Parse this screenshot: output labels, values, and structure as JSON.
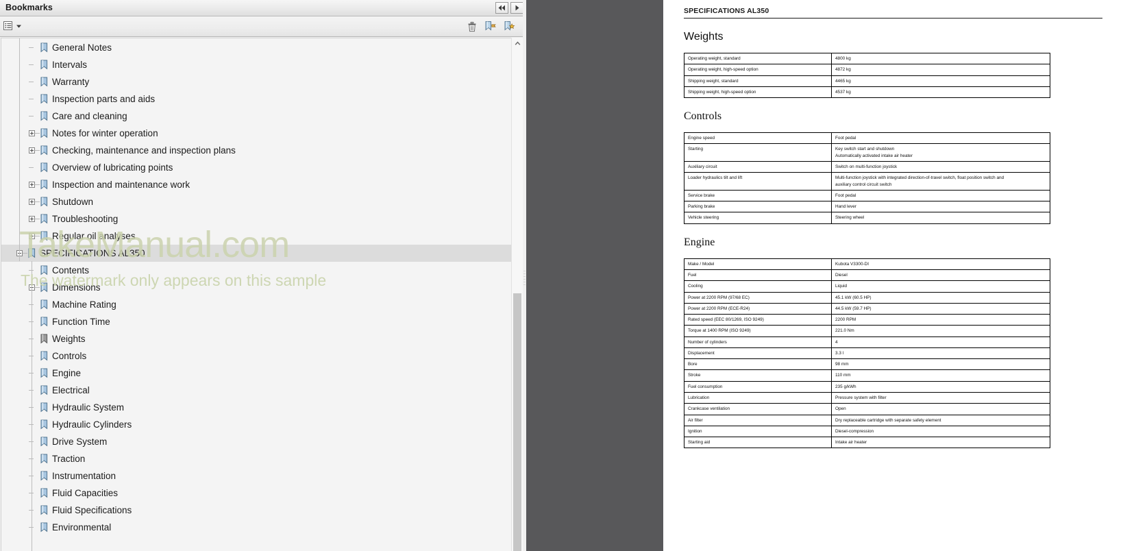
{
  "panel": {
    "title": "Bookmarks",
    "header_buttons": [
      {
        "name": "collapse-panel-button",
        "icon": "double-left-arrow-icon",
        "label": "◀◀"
      },
      {
        "name": "expand-panel-button",
        "icon": "right-arrow-icon",
        "label": "▶"
      }
    ],
    "toolbar": {
      "options_label": "Options",
      "options_icon": "options-list-icon",
      "delete_icon": "trash-icon",
      "new_bookmark_icon": "new-bookmark-icon",
      "new_bookmark_alt_icon": "new-bookmark-alt-icon"
    },
    "watermark": {
      "main": "TakeManual.com",
      "sub": "The watermark only appears on this sample"
    },
    "bookmarks": [
      {
        "label": "General Notes",
        "indent": 1,
        "toggle": "none",
        "selected": false,
        "icon": "bookmark-ribbon-icon"
      },
      {
        "label": "Intervals",
        "indent": 1,
        "toggle": "none",
        "selected": false,
        "icon": "bookmark-ribbon-icon"
      },
      {
        "label": "Warranty",
        "indent": 1,
        "toggle": "none",
        "selected": false,
        "icon": "bookmark-ribbon-icon"
      },
      {
        "label": "Inspection parts and aids",
        "indent": 1,
        "toggle": "none",
        "selected": false,
        "icon": "bookmark-ribbon-icon"
      },
      {
        "label": "Care and cleaning",
        "indent": 1,
        "toggle": "none",
        "selected": false,
        "icon": "bookmark-ribbon-icon"
      },
      {
        "label": "Notes for winter operation",
        "indent": 1,
        "toggle": "plus",
        "selected": false,
        "icon": "bookmark-ribbon-icon"
      },
      {
        "label": "Checking, maintenance and inspection plans",
        "indent": 1,
        "toggle": "plus",
        "selected": false,
        "icon": "bookmark-ribbon-icon"
      },
      {
        "label": "Overview of lubricating points",
        "indent": 1,
        "toggle": "none",
        "selected": false,
        "icon": "bookmark-ribbon-icon"
      },
      {
        "label": "Inspection and maintenance work",
        "indent": 1,
        "toggle": "plus",
        "selected": false,
        "icon": "bookmark-ribbon-icon"
      },
      {
        "label": "Shutdown",
        "indent": 1,
        "toggle": "plus",
        "selected": false,
        "icon": "bookmark-ribbon-icon"
      },
      {
        "label": "Troubleshooting",
        "indent": 1,
        "toggle": "plus",
        "selected": false,
        "icon": "bookmark-ribbon-icon"
      },
      {
        "label": "Regular oil analyses",
        "indent": 1,
        "toggle": "plus",
        "selected": false,
        "icon": "bookmark-ribbon-icon"
      },
      {
        "label": "SPECIFICATIONS AL350",
        "indent": 0,
        "toggle": "minus",
        "selected": true,
        "icon": "bookmark-ribbon-icon"
      },
      {
        "label": "Contents",
        "indent": 1,
        "toggle": "none",
        "selected": false,
        "icon": "bookmark-ribbon-icon"
      },
      {
        "label": "Dimensions",
        "indent": 1,
        "toggle": "plus",
        "selected": false,
        "icon": "bookmark-ribbon-icon"
      },
      {
        "label": "Machine Rating",
        "indent": 1,
        "toggle": "none",
        "selected": false,
        "icon": "bookmark-ribbon-icon"
      },
      {
        "label": "Function Time",
        "indent": 1,
        "toggle": "none",
        "selected": false,
        "icon": "bookmark-ribbon-icon"
      },
      {
        "label": "Weights",
        "indent": 1,
        "toggle": "none",
        "selected": false,
        "icon": "bookmark-ribbon-gray-icon"
      },
      {
        "label": "Controls",
        "indent": 1,
        "toggle": "none",
        "selected": false,
        "icon": "bookmark-ribbon-icon"
      },
      {
        "label": "Engine",
        "indent": 1,
        "toggle": "none",
        "selected": false,
        "icon": "bookmark-ribbon-icon"
      },
      {
        "label": "Electrical",
        "indent": 1,
        "toggle": "none",
        "selected": false,
        "icon": "bookmark-ribbon-icon"
      },
      {
        "label": "Hydraulic System",
        "indent": 1,
        "toggle": "none",
        "selected": false,
        "icon": "bookmark-ribbon-icon"
      },
      {
        "label": "Hydraulic Cylinders",
        "indent": 1,
        "toggle": "none",
        "selected": false,
        "icon": "bookmark-ribbon-icon"
      },
      {
        "label": "Drive System",
        "indent": 1,
        "toggle": "none",
        "selected": false,
        "icon": "bookmark-ribbon-icon"
      },
      {
        "label": "Traction",
        "indent": 1,
        "toggle": "none",
        "selected": false,
        "icon": "bookmark-ribbon-icon"
      },
      {
        "label": "Instrumentation",
        "indent": 1,
        "toggle": "none",
        "selected": false,
        "icon": "bookmark-ribbon-icon"
      },
      {
        "label": "Fluid Capacities",
        "indent": 1,
        "toggle": "none",
        "selected": false,
        "icon": "bookmark-ribbon-icon"
      },
      {
        "label": "Fluid Specifications",
        "indent": 1,
        "toggle": "none",
        "selected": false,
        "icon": "bookmark-ribbon-icon"
      },
      {
        "label": "Environmental",
        "indent": 1,
        "toggle": "none",
        "selected": false,
        "icon": "bookmark-ribbon-icon"
      }
    ]
  },
  "document": {
    "running_head": "SPECIFICATIONS AL350",
    "sections": [
      {
        "heading": "Weights",
        "rows": [
          {
            "key": "Operating weight, standard",
            "values": [
              "4800 kg"
            ]
          },
          {
            "key": "Operating weight, high-speed option",
            "values": [
              "4872 kg"
            ]
          },
          {
            "key": "Shipping weight, standard",
            "values": [
              "4465 kg"
            ]
          },
          {
            "key": "Shipping weight, high-speed option",
            "values": [
              "4537 kg"
            ]
          }
        ]
      },
      {
        "heading": "Controls",
        "rows": [
          {
            "key": "Engine speed",
            "values": [
              "Foot pedal"
            ]
          },
          {
            "key": "Starting",
            "values": [
              "Key switch start and shutdown",
              "Automatically activated intake air heater"
            ]
          },
          {
            "key": "Auxiliary circuit",
            "values": [
              "Switch on multi-function joystick"
            ]
          },
          {
            "key": "Loader hydraulics tilt and lift",
            "values": [
              "Multi-function joystick with integrated direction-of-travel switch, float position switch and",
              "auxiliary control circuit switch"
            ]
          },
          {
            "key": "Service brake",
            "values": [
              "Foot pedal"
            ]
          },
          {
            "key": "Parking brake",
            "values": [
              "Hand lever"
            ]
          },
          {
            "key": "Vehicle steering",
            "values": [
              "Steering wheel"
            ]
          }
        ]
      },
      {
        "heading": "Engine",
        "rows": [
          {
            "key": "Make / Model",
            "values": [
              "Kubota V3300-DI"
            ]
          },
          {
            "key": "Fuel",
            "values": [
              "Diesel"
            ]
          },
          {
            "key": "Cooling",
            "values": [
              "Liquid"
            ]
          },
          {
            "key": "Power at 2200 RPM (97/68 EC)",
            "values": [
              "45.1 kW (60.5 HP)"
            ]
          },
          {
            "key": "Power at 2200 RPM (ECE-R24)",
            "values": [
              "44.5 kW (59.7 HP)"
            ]
          },
          {
            "key": "Rated speed (EEC 80/1269, ISO 9249)",
            "values": [
              "2200 RPM"
            ]
          },
          {
            "key": "Torque at 1400 RPM (ISO 9249)",
            "values": [
              "221.0 Nm"
            ]
          },
          {
            "key": "Number of cylinders",
            "values": [
              "4"
            ]
          },
          {
            "key": "Displacement",
            "values": [
              "3.3 l"
            ]
          },
          {
            "key": "Bore",
            "values": [
              "98 mm"
            ]
          },
          {
            "key": "Stroke",
            "values": [
              "110 mm"
            ]
          },
          {
            "key": "Fuel consumption",
            "values": [
              "235 g/kWh"
            ]
          },
          {
            "key": "Lubrication",
            "values": [
              "Pressure system with filter"
            ]
          },
          {
            "key": "Crankcase ventilation",
            "values": [
              "Open"
            ]
          },
          {
            "key": "Air filter",
            "values": [
              "Dry replaceable cartridge with separate safety element"
            ]
          },
          {
            "key": "Ignition",
            "values": [
              "Diesel-compression"
            ]
          },
          {
            "key": "Starting aid",
            "values": [
              "Intake air heater"
            ]
          }
        ]
      }
    ]
  },
  "colors": {
    "gutter": "#58585a",
    "selection": "#dcdcdc",
    "bookmark_blue": "#a8c6e0",
    "bookmark_gray": "#9b9b9b",
    "watermark": "#cbd3ae"
  }
}
